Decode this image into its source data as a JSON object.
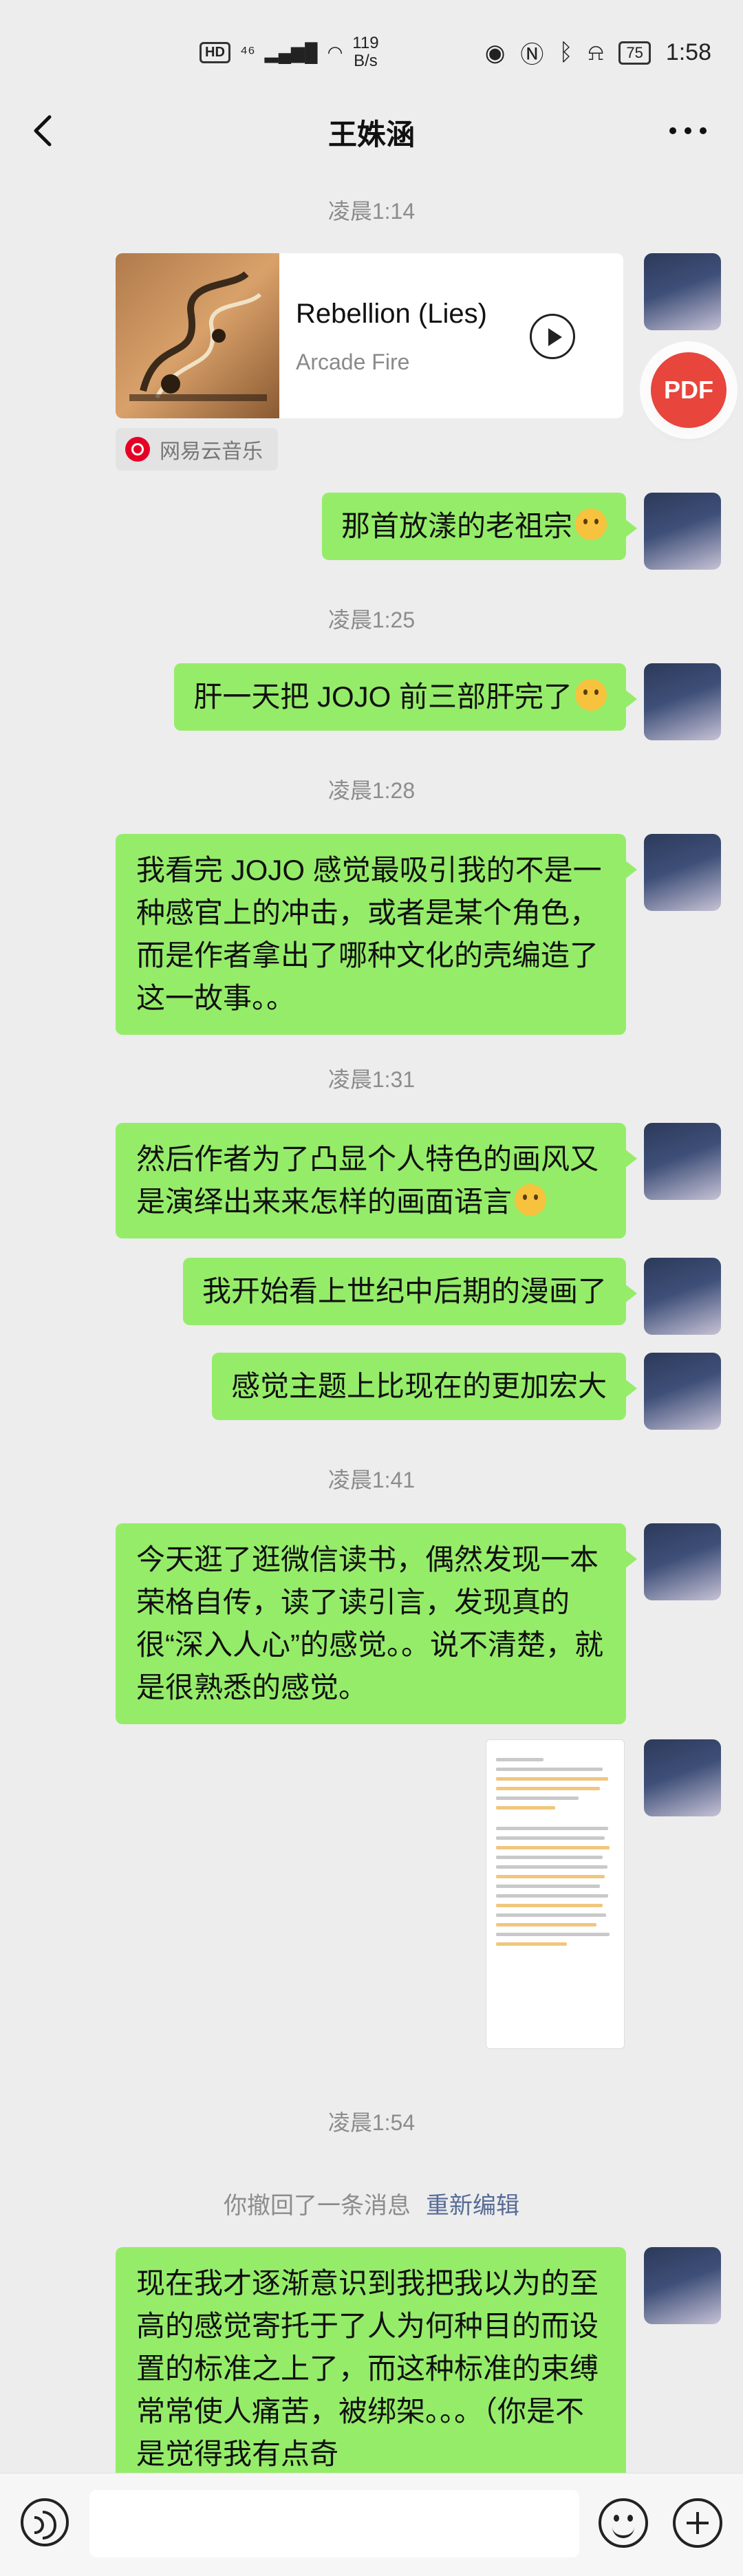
{
  "status_bar": {
    "hd": "HD",
    "network": "⁴⁶",
    "speed_value": "119",
    "speed_unit": "B/s",
    "battery": "75",
    "time": "1:58"
  },
  "header": {
    "title": "王姝涵"
  },
  "timestamps": [
    "凌晨1:14",
    "凌晨1:25",
    "凌晨1:28",
    "凌晨1:31",
    "凌晨1:41",
    "凌晨1:54"
  ],
  "music_card": {
    "title": "Rebellion (Lies)",
    "artist": "Arcade Fire",
    "source": "网易云音乐"
  },
  "pdf_button": "PDF",
  "messages": [
    "那首放漾的老祖宗",
    "肝一天把 JOJO 前三部肝完了",
    "我看完 JOJO 感觉最吸引我的不是一种感官上的冲击，或者是某个角色，而是作者拿出了哪种文化的壳编造了这一故事。。",
    "然后作者为了凸显个人特色的画风又是演绎出来来怎样的画面语言",
    "我开始看上世纪中后期的漫画了",
    "感觉主题上比现在的更加宏大",
    "今天逛了逛微信读书，偶然发现一本荣格自传，读了读引言，发现真的很“深入人心”的感觉。。说不清楚，就是很熟悉的感觉。",
    "现在我才逐渐意识到我把我以为的至高的感觉寄托于了人为何种目的而设置的标准之上了，而这种标准的束缚常常使人痛苦，被绑架。。。（你是不是觉得我有点奇"
  ],
  "recall": {
    "text": "你撤回了一条消息",
    "reedit": "重新编辑"
  },
  "input": {
    "placeholder": ""
  }
}
